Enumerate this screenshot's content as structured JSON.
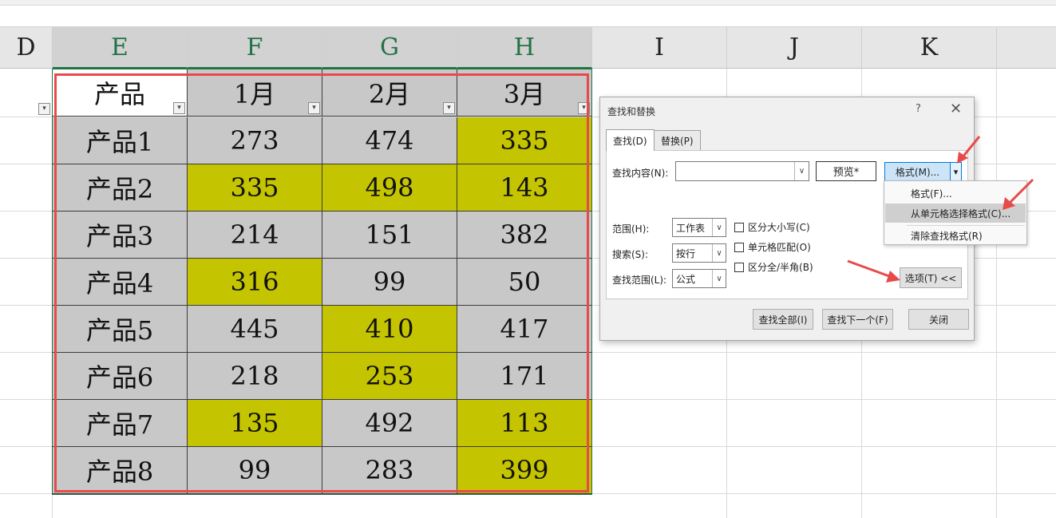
{
  "columns": [
    "D",
    "E",
    "F",
    "G",
    "H",
    "I",
    "J",
    "K"
  ],
  "table": {
    "header": [
      "产品",
      "1月",
      "2月",
      "3月"
    ],
    "rows": [
      [
        "产品1",
        "273",
        "474",
        "335"
      ],
      [
        "产品2",
        "335",
        "498",
        "143"
      ],
      [
        "产品3",
        "214",
        "151",
        "382"
      ],
      [
        "产品4",
        "316",
        "99",
        "50"
      ],
      [
        "产品5",
        "445",
        "410",
        "417"
      ],
      [
        "产品6",
        "218",
        "253",
        "171"
      ],
      [
        "产品7",
        "135",
        "492",
        "113"
      ],
      [
        "产品8",
        "99",
        "283",
        "399"
      ]
    ]
  },
  "colors": {
    "highlight": "#c4c400",
    "cell_gray": "#c8c8c8",
    "selection_red": "#e84a4a",
    "excel_green": "#217346"
  },
  "dialog": {
    "title": "查找和替换",
    "help": "?",
    "close_glyph": "✕",
    "tabs": [
      "查找(D)",
      "替换(P)"
    ],
    "find_label": "查找内容(N):",
    "find_value": "",
    "preview": "预览*",
    "format_button": "格式(M)...",
    "format_arrow": "▾",
    "options": {
      "scope_label": "范围(H):",
      "scope_value": "工作表",
      "search_label": "搜索(S):",
      "search_value": "按行",
      "lookin_label": "查找范围(L):",
      "lookin_value": "公式"
    },
    "checkboxes": [
      "区分大小写(C)",
      "单元格匹配(O)",
      "区分全/半角(B)"
    ],
    "options_button": "选项(T) <<",
    "buttons": {
      "find_all": "查找全部(I)",
      "find_next": "查找下一个(F)",
      "close": "关闭"
    }
  },
  "format_menu": [
    "格式(F)...",
    "从单元格选择格式(C)...",
    "清除查找格式(R)"
  ]
}
